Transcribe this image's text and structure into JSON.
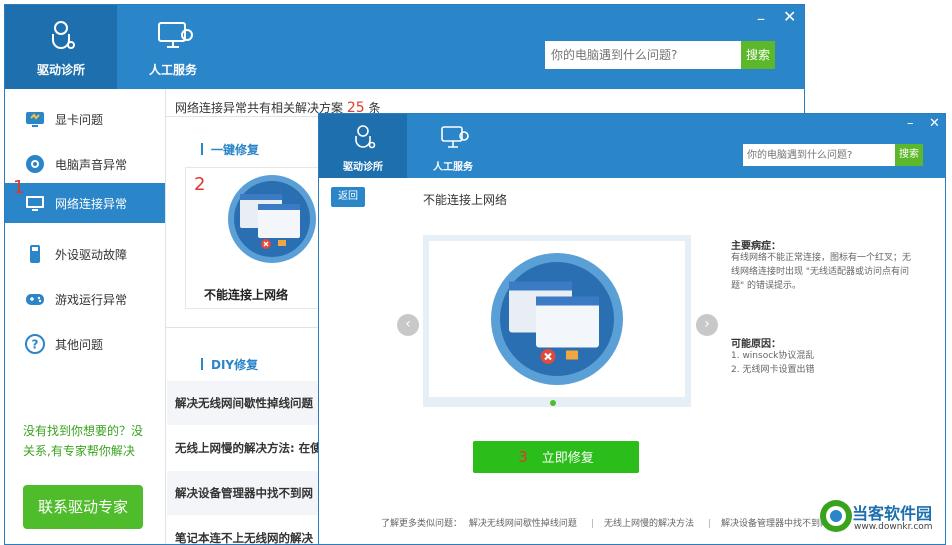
{
  "back_window": {
    "tabs": [
      {
        "label": "驱动诊所",
        "icon": "stethoscope-icon"
      },
      {
        "label": "人工服务",
        "icon": "monitor-service-icon"
      }
    ],
    "search_placeholder": "你的电脑遇到什么问题?",
    "search_button": "搜索",
    "sidebar": [
      {
        "label": "显卡问题",
        "icon": "display-card-icon"
      },
      {
        "label": "电脑声音异常",
        "icon": "speaker-icon"
      },
      {
        "label": "网络连接异常",
        "icon": "network-monitor-icon"
      },
      {
        "label": "外设驱动故障",
        "icon": "usb-device-icon"
      },
      {
        "label": "游戏运行异常",
        "icon": "gamepad-icon"
      },
      {
        "label": "其他问题",
        "icon": "question-icon"
      }
    ],
    "sidebar_help": "没有找到你想要的？没关系,有专家帮你解决",
    "contact_button": "联系驱动专家",
    "count_prefix": "网络连接异常共有相关解决方案",
    "count_value": "25",
    "count_suffix": "条",
    "one_click_section": "一键修复",
    "card_title": "不能连接上网络",
    "diy_section": "DIY修复",
    "diy_items": [
      "解决无线网间歇性掉线问题",
      "无线上网慢的解决方法: 在使",
      "解决设备管理器中找不到网",
      "笔记本连不上无线网的解决"
    ],
    "markers": {
      "one": "1",
      "two": "2"
    }
  },
  "front_window": {
    "tabs": [
      {
        "label": "驱动诊所",
        "icon": "stethoscope-icon"
      },
      {
        "label": "人工服务",
        "icon": "monitor-service-icon"
      }
    ],
    "search_placeholder": "你的电脑遇到什么问题?",
    "search_button": "搜索",
    "back_button": "返回",
    "title": "不能连接上网络",
    "symptom_title": "主要病症：",
    "symptom_text": "有线网络不能正常连接，图标有一个红叉；无线网络连接时出现 \"无线适配器或访问点有问题\" 的错误提示。",
    "cause_title": "可能原因：",
    "causes": [
      "1. winsock协议混乱",
      "2. 无线网卡设置出错"
    ],
    "fix_number": "3",
    "fix_button": "立即修复",
    "more_label": "了解更多类似问题：",
    "more_links": [
      "解决无线网间歇性掉线问题",
      "无线上网慢的解决方法",
      "解决设备管理器中找不到网"
    ],
    "gallery_dot_active": 1
  },
  "watermark": {
    "name": "当客软件园",
    "url": "www.downkr.com"
  }
}
